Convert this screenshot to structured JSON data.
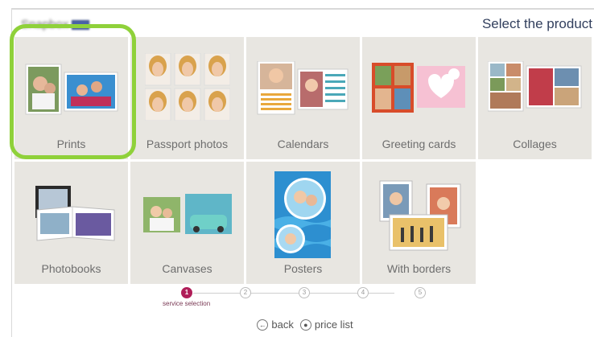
{
  "header": {
    "brand_text": "Snapbox",
    "title": "Select the product"
  },
  "products": [
    {
      "label": "Prints"
    },
    {
      "label": "Passport photos"
    },
    {
      "label": "Calendars"
    },
    {
      "label": "Greeting cards"
    },
    {
      "label": "Collages"
    },
    {
      "label": "Photobooks"
    },
    {
      "label": "Canvases"
    },
    {
      "label": "Posters"
    },
    {
      "label": "With borders"
    }
  ],
  "selected_product": "Prints",
  "steps": {
    "items": [
      "1",
      "2",
      "3",
      "4",
      "5"
    ],
    "active_caption": "service selection"
  },
  "footer": {
    "back_label": "back",
    "price_list_label": "price list"
  },
  "colors": {
    "accent": "#8fd13a",
    "step_active": "#b01e59",
    "tile_bg": "#e8e6e1"
  }
}
